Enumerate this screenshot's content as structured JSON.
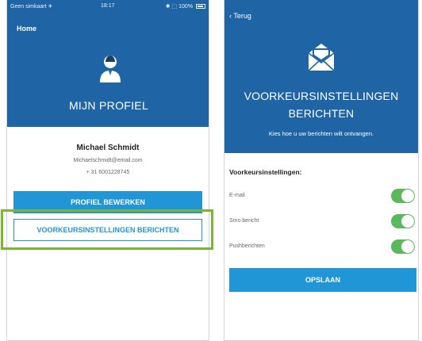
{
  "left_screen": {
    "status_bar": {
      "carrier": "Geen simkaart ✈",
      "time": "18:17",
      "battery": "✱ ⬚ 100%"
    },
    "nav": {
      "home_label": "Home"
    },
    "header": {
      "title": "MIJN PROFIEL",
      "icon": "user-icon"
    },
    "user": {
      "name": "Michael Schmidt",
      "email": "Michaelschmidt@email.com",
      "phone": "+ 31  6001228745"
    },
    "buttons": {
      "edit_profile": "PROFIEL BEWERKEN",
      "message_preferences": "VOORKEURSINSTELLINGEN BERICHTEN"
    },
    "highlight_color": "#78b634"
  },
  "right_screen": {
    "nav": {
      "back_label": "‹ Terug"
    },
    "header": {
      "icon": "envelope-icon",
      "title_line1": "VOORKEURSINSTELLINGEN",
      "title_line2": "BERICHTEN",
      "subtitle": "Kies hoe u uw berichten wilt ontvangen."
    },
    "section_heading": "Voorkeursinstellingen:",
    "preferences": [
      {
        "label": "E-mail",
        "enabled": true
      },
      {
        "label": "Sms-bericht",
        "enabled": true
      },
      {
        "label": "Pushberichten",
        "enabled": true
      }
    ],
    "save_label": "OPSLAAN"
  },
  "colors": {
    "header_blue": "#1f65a6",
    "button_blue": "#2196d6",
    "toggle_green": "#5cb85c"
  }
}
